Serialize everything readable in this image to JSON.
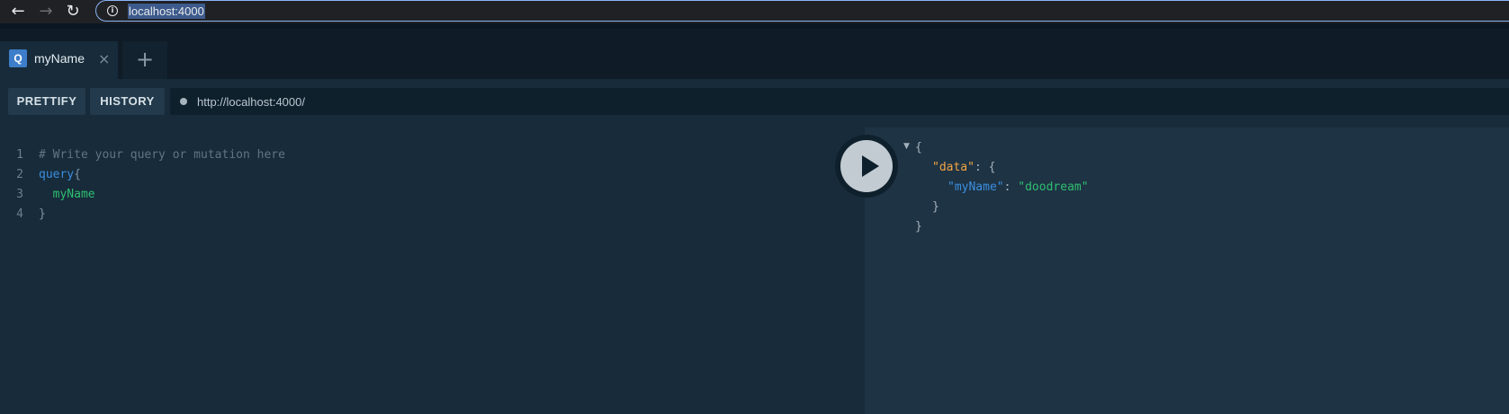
{
  "browser": {
    "url": "localhost:4000",
    "back_icon": "←",
    "forward_icon": "→",
    "reload_icon": "↻",
    "info_icon": "i"
  },
  "tabs": {
    "items": [
      {
        "badge": "Q",
        "label": "myName",
        "close": "×"
      }
    ],
    "add_icon": "+"
  },
  "toolbar": {
    "prettify_label": "PRETTIFY",
    "history_label": "HISTORY",
    "endpoint_url": "http://localhost:4000/"
  },
  "editor": {
    "lines": [
      {
        "number": "1",
        "text": "# Write your query or mutation here"
      },
      {
        "number": "2",
        "keyword": "query",
        "punct": "{"
      },
      {
        "number": "3",
        "field": "  myName"
      },
      {
        "number": "4",
        "punct": "}"
      }
    ]
  },
  "result": {
    "fold_icon": "▼",
    "open_brace": "{",
    "data_key": "\"data\"",
    "colon": ": ",
    "inner_open": "{",
    "field_key": "\"myName\"",
    "field_value": "\"doodream\"",
    "inner_close": "}",
    "close_brace": "}"
  },
  "colors": {
    "accent": "#3d7dca",
    "keyword": "#3b8fe0",
    "string": "#2fbf71",
    "data_key": "#f1a545"
  }
}
